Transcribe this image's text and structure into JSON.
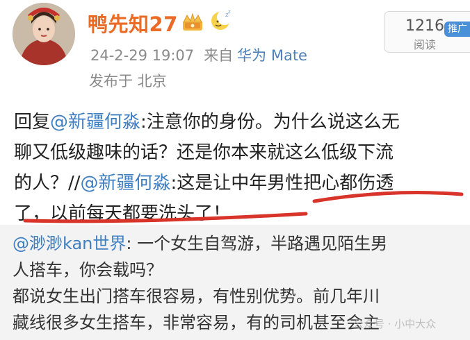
{
  "post": {
    "username": "鸭先知27",
    "timestamp": "24-2-29 19:07",
    "source_prefix": "来自",
    "device": "华为 Mate",
    "location": "发布于 北京",
    "read_count": "1216",
    "read_label": "阅读",
    "promo_tag": "推广"
  },
  "reply": {
    "line1_prefix": "回复",
    "line1_mention": "@新疆何淼",
    "line1_text": ":注意你的身份。为什么说这么无",
    "line2_text": "聊又低级趣味的话？还是你本来就这么低级下流",
    "line3_prefix": "的人？//",
    "line3_mention": "@新疆何淼",
    "line3_text": ":这是让中年男性把心都伤透",
    "line4_text": "了，以前每天都要洗头了！"
  },
  "quoted": {
    "mention": "@渺渺kan世界",
    "line1_text": ": 一个女生自驾游，半路遇见陌生男",
    "line2_text": "人搭车，你会载吗？",
    "line3_text": "都说女生出门搭车很容易，有性别优势。前几年川",
    "line4_text": "藏线很多女生搭车，非常容易，有的司机甚至会主"
  },
  "watermark": "公众号 · 小中大众",
  "colors": {
    "username": "#ea6b26",
    "mention": "#3f7fc1",
    "underline": "#d8342a",
    "quoted_bg": "#f3f3f3",
    "promo": "#4a90d9"
  },
  "icons": [
    "crown-badge-icon",
    "moon-badge-icon"
  ]
}
